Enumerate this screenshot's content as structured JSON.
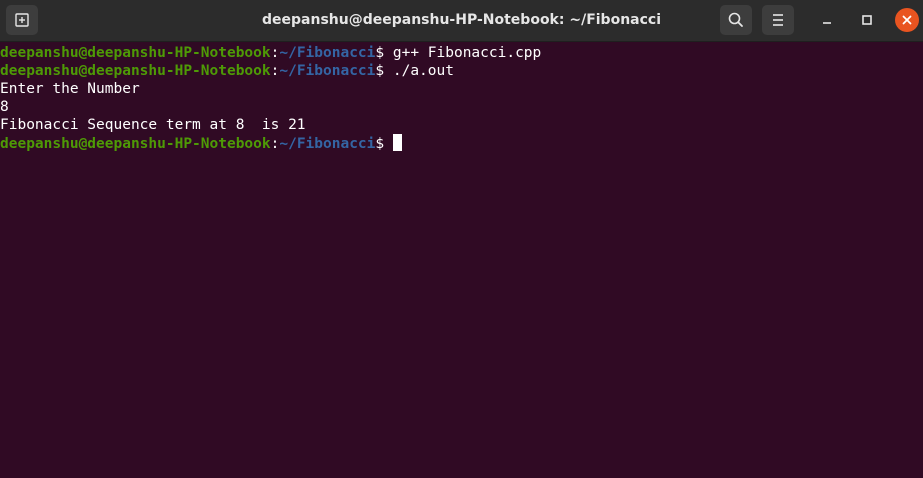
{
  "window": {
    "title": "deepanshu@deepanshu-HP-Notebook: ~/Fibonacci",
    "icons": {
      "new_tab": "new-tab-icon",
      "search": "search-icon",
      "menu": "hamburger-menu-icon",
      "minimize": "minimize-icon",
      "maximize": "maximize-icon",
      "close": "close-icon"
    },
    "colors": {
      "terminal_bg": "#300a24",
      "titlebar_bg": "#2c2c2c",
      "prompt_user": "#4e9a06",
      "prompt_path": "#3465a4",
      "close_button": "#e95420"
    }
  },
  "terminal": {
    "lines": [
      {
        "type": "prompt",
        "user": "deepanshu@deepanshu-HP-Notebook",
        "sep": ":",
        "path": "~/Fibonacci",
        "symbol": "$ ",
        "command": "g++ Fibonacci.cpp"
      },
      {
        "type": "prompt",
        "user": "deepanshu@deepanshu-HP-Notebook",
        "sep": ":",
        "path": "~/Fibonacci",
        "symbol": "$ ",
        "command": "./a.out"
      },
      {
        "type": "output",
        "text": "Enter the Number"
      },
      {
        "type": "output",
        "text": "8"
      },
      {
        "type": "output",
        "text": "Fibonacci Sequence term at 8  is 21"
      },
      {
        "type": "prompt",
        "user": "deepanshu@deepanshu-HP-Notebook",
        "sep": ":",
        "path": "~/Fibonacci",
        "symbol": "$ ",
        "command": ""
      }
    ]
  }
}
